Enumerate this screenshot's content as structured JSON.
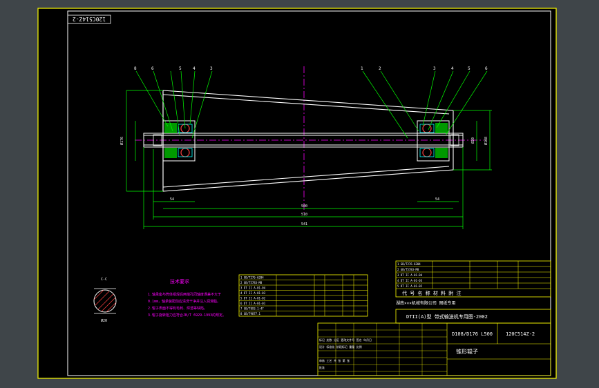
{
  "drawing": {
    "sheet_id_rotated": "120C514Z-2",
    "drawing_number": "120C514Z-2",
    "spec": "D108/D176 L500",
    "part_name": "锥形辊子",
    "series_title": "DTII(A)型  带式输送机专用图-2002",
    "company_line": "湖南×××机械有限公司  图纸专用",
    "header_code_row": "代 号        名 称        材 料     附 注",
    "tech_req_title": "技术要求",
    "tech_req_lines": [
      "1.轴承座与筒体组焊后两端孔同轴度误差不大于",
      "  0.1mm，轴承装配前应清洗干净并注入润滑脂。",
      "2.辊子表面不得有毛刺、焊渣等缺陷。",
      "3.辊子旋转阻力应符合JB/T 6929-1993的规定。"
    ],
    "section_label": "C-C",
    "section_dim": "Ø20",
    "callouts_left": [
      "8",
      "6",
      "5",
      "4",
      "3"
    ],
    "callouts_right": [
      "1",
      "2",
      "3",
      "4",
      "5",
      "6"
    ],
    "dims": [
      "Ø108",
      "Ø176",
      "Ø20",
      "500",
      "510",
      "541",
      "54",
      "54"
    ],
    "left_parts": [
      "1  GB/T276-6204",
      "2  GB/T5783-M8",
      "3  DT II A-01-04",
      "4  DT II A-01-03",
      "5  DT II A-01-02",
      "6  DT II A-01-01",
      "7  GB/T893.1-47",
      "8  GB/T9877.1"
    ],
    "right_parts": [
      "1  GB/T276-6204",
      "2  GB/T5783-M8",
      "3  DT II A-01-04",
      "4  DT II A-01-03",
      "5  DT II A-01-02",
      "6  DT II A-01-01"
    ],
    "rev_rows": [
      "标记 处数 分区 更改文件号 签名 年月日",
      "设计    标准化    阶段标记  重量  比例",
      "审核    工艺    共  张  第  张",
      "批准"
    ]
  }
}
